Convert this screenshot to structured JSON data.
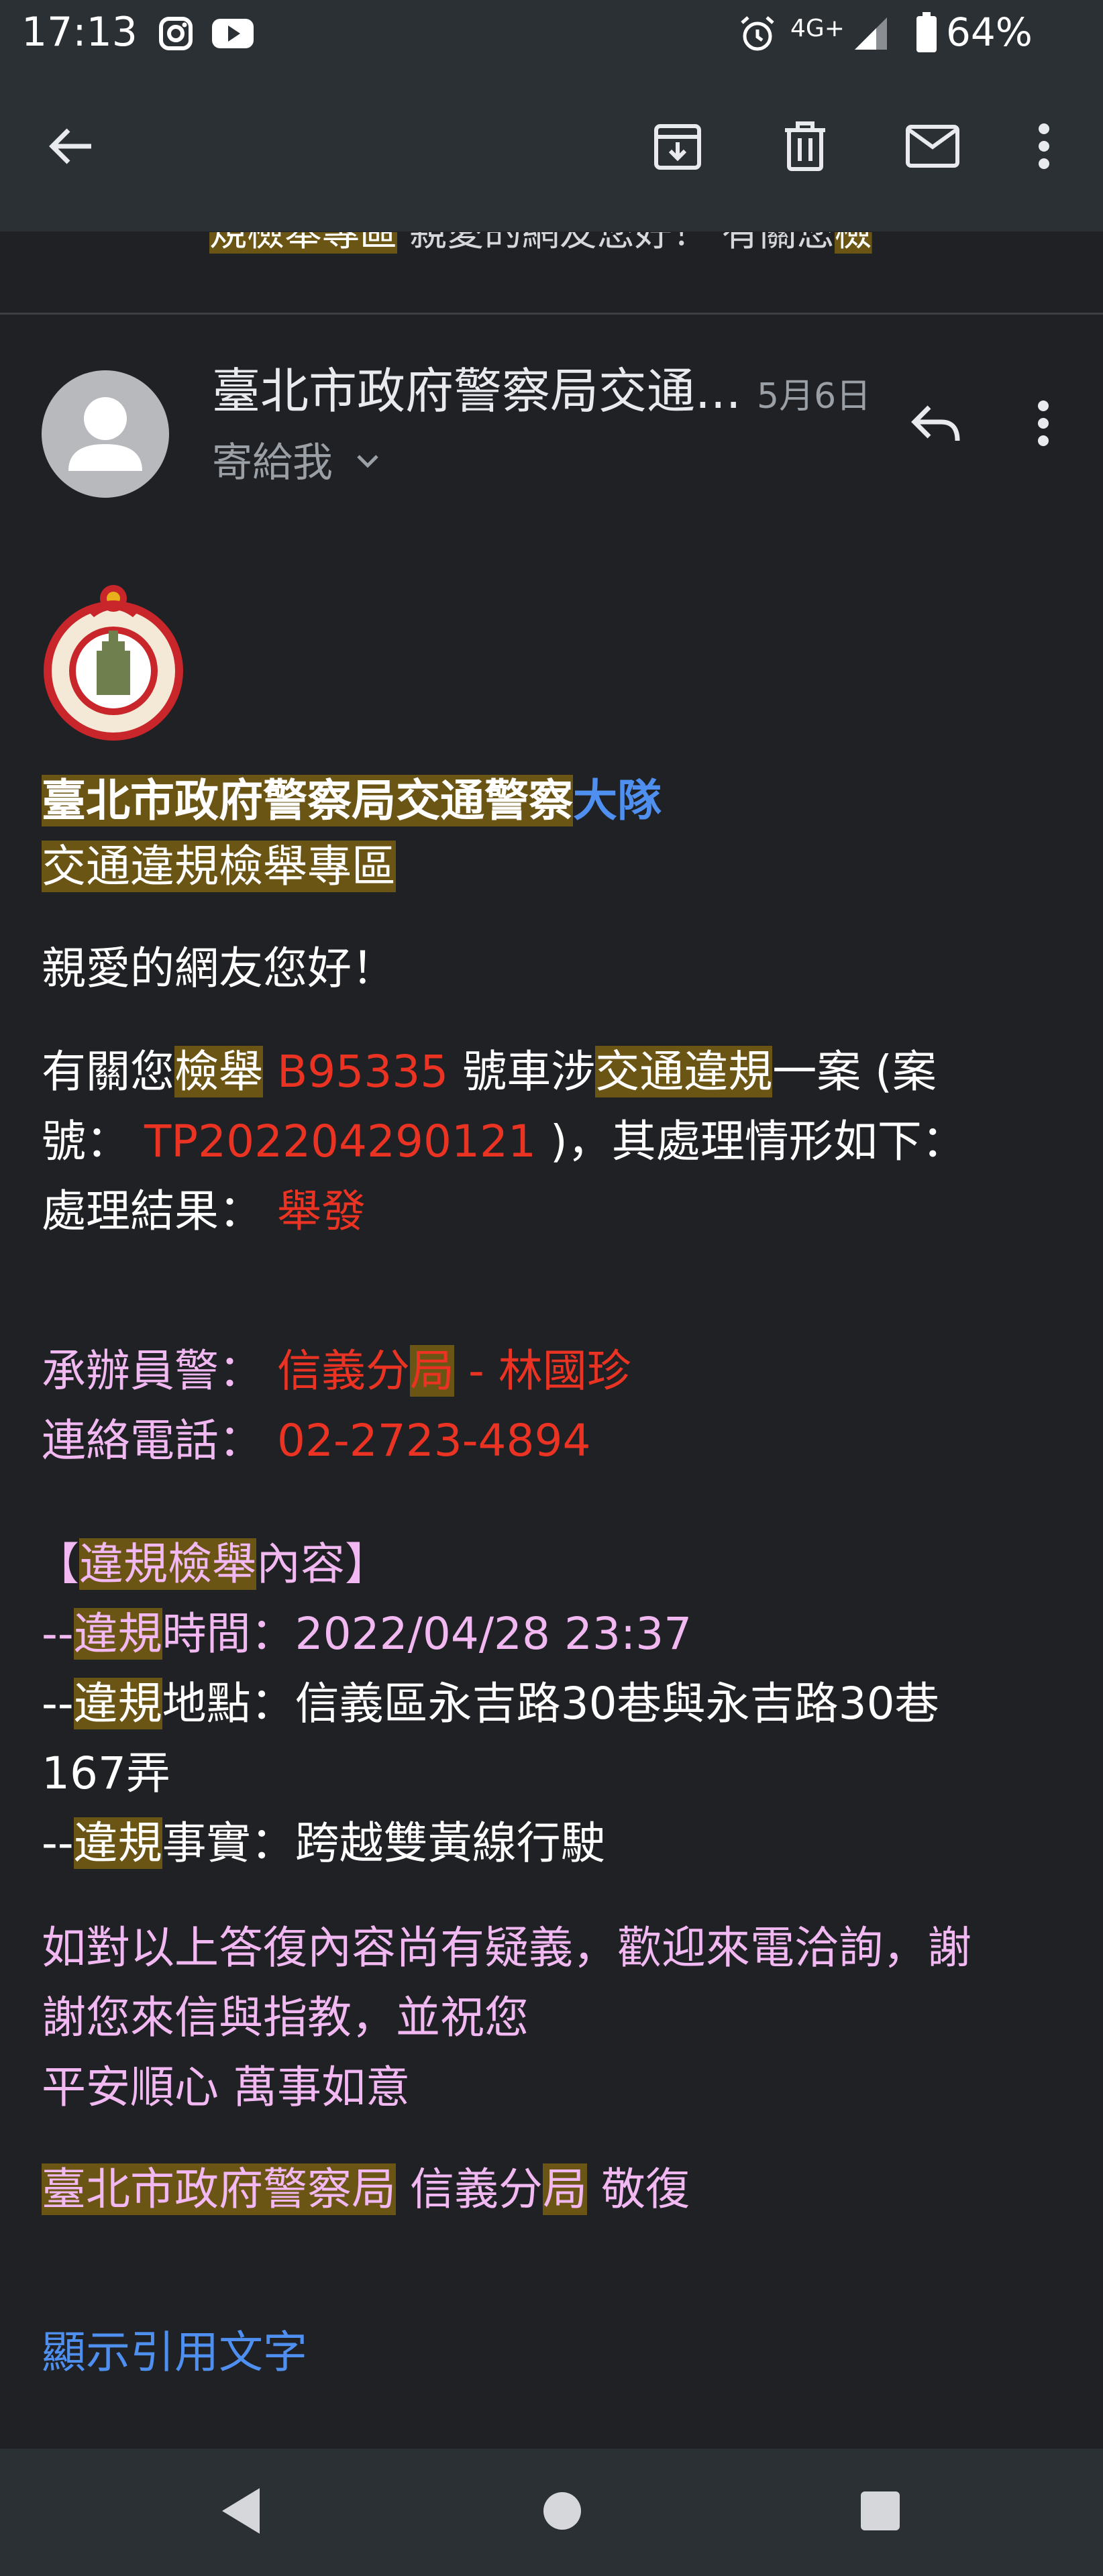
{
  "status_bar": {
    "time": "17:13",
    "network": "4G+",
    "battery": "64%",
    "icons": [
      "instagram-icon",
      "youtube-icon",
      "alarm-icon",
      "signal-icon",
      "battery-icon"
    ]
  },
  "app_bar": {
    "icons": [
      "back-arrow-icon",
      "archive-icon",
      "delete-icon",
      "mark-unread-icon",
      "more-vert-icon"
    ]
  },
  "peek": {
    "highlight_text": "規檢舉專區",
    "text": " 親愛的網友您好！ 有關您",
    "highlight_tail": "檢"
  },
  "message_header": {
    "sender": "臺北市政府警察局交通...",
    "date": "5月6日",
    "recipient": "寄給我",
    "icons": [
      "avatar-person-icon",
      "chevron-down-icon",
      "reply-icon",
      "more-vert-icon"
    ]
  },
  "body": {
    "title_part1": "臺北市政府警察局交通警察",
    "title_part2": "大隊",
    "subtitle": "交通違規檢舉專區",
    "greeting": "親愛的網友您好！",
    "p1": {
      "a": "有關您",
      "b": "檢舉",
      "c": " B95335",
      "d": " 號車涉",
      "e": "交通違規",
      "f": "一案 (案",
      "g": "號：",
      "h": " TP202204290121",
      "i": " )，其處理情形如下：",
      "j": "處理結果：",
      "k": " 舉發"
    },
    "officer": {
      "label": "承辦員警：",
      "unit_a": " 信義分",
      "unit_b": "局",
      "name": " - 林國珍"
    },
    "phone": {
      "label": "連絡電話：",
      "value": " 02-2723-4894"
    },
    "section_title": {
      "open": "【",
      "a": "違規檢舉",
      "b": "內容",
      "close": "】"
    },
    "time_row": {
      "dash": "--",
      "hl": "違規",
      "text": "時間：2022/04/28 23:37"
    },
    "place_row": {
      "dash": "--",
      "hl": "違規",
      "text": "地點：信義區永吉路30巷與永吉路30巷",
      "cont": "167弄"
    },
    "fact_row": {
      "dash": "--",
      "hl": "違規",
      "text": "事實：跨越雙黃線行駛"
    },
    "closing1": "如對以上答復內容尚有疑義，歡迎來電洽詢，謝",
    "closing2": "謝您來信與指教，並祝您",
    "closing3": "平安順心 萬事如意",
    "sign_a": "臺北市政府警察局",
    "sign_b": " 信義分",
    "sign_c": "局",
    "sign_d": " 敬復",
    "show_quoted": "顯示引用文字"
  },
  "colors": {
    "background": "#202124",
    "bar": "#2b3035",
    "highlight": "#6b5514",
    "red": "#ea3323",
    "pink": "#f2b8f2",
    "link_blue": "#4f8ff0"
  },
  "nav_bar": {
    "icons": [
      "nav-back-icon",
      "nav-home-icon",
      "nav-recents-icon"
    ]
  }
}
